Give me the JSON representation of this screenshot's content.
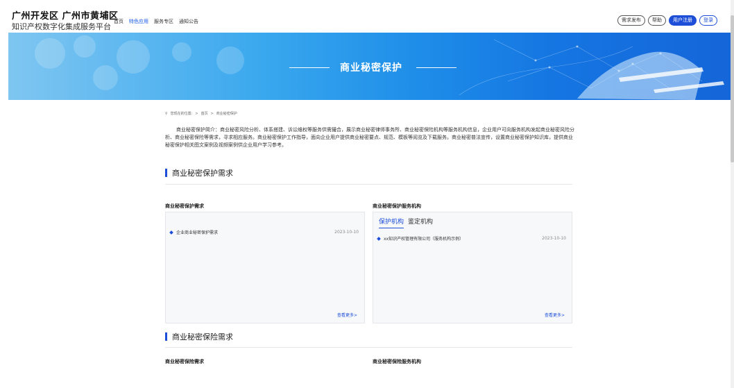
{
  "brand": {
    "line1": "广州开发区 广州市黄埔区",
    "line2": "知识产权数字化集成服务平台"
  },
  "nav": [
    {
      "label": "首页",
      "active": false
    },
    {
      "label": "特色应用",
      "active": true
    },
    {
      "label": "服务专区",
      "active": false
    },
    {
      "label": "通知公告",
      "active": false
    }
  ],
  "header_buttons": {
    "publish": "需求发布",
    "help": "帮助",
    "register": "用户注册",
    "login": "登录"
  },
  "banner": {
    "title": "商业秘密保护"
  },
  "breadcrumb": {
    "prefix": "您现在的位置:",
    "home": "首页",
    "current": "商业秘密保护",
    "sep": ">"
  },
  "intro": "商业秘密保护简介：商业秘密风险分析、体系搭建、诉讼维权等服务供需撮合，展示商业秘密律师事务所、商业秘密保险机构等服务机构信息，企业用户可向服务机构发起商业秘密风险分析、商业秘密保险等需求，寻求相应服务。商业秘密保护工作指导，面向企业用户提供商业秘密要点、规范、模板等阅览及下载服务。商业秘密普法宣传，设置商业秘密保护知识库，提供商业秘密保护相关图文案例及视频案例供企业用户学习参考。",
  "sections": [
    {
      "title": "商业秘密保护需求",
      "left_panel": {
        "heading": "商业秘密保护需求",
        "items": [
          {
            "name": "企业商业秘密保护需求",
            "date": "2023-10-10"
          }
        ],
        "more": "查看更多>"
      },
      "right_panel": {
        "heading": "商业秘密保护服务机构",
        "tabs": [
          "保护机构",
          "鉴定机构"
        ],
        "items": [
          {
            "name": "xx知识产权管理有限公司（服务机构示例）",
            "date": "2023-10-10"
          }
        ],
        "more": "查看更多>"
      }
    },
    {
      "title": "商业秘密保险需求",
      "left_heading": "商业秘密保险需求",
      "right_heading": "商业秘密保险服务机构"
    }
  ],
  "colors": {
    "accent": "#1d4ed8",
    "banner_start": "#7fc6f1",
    "banner_end": "#1565d8"
  }
}
